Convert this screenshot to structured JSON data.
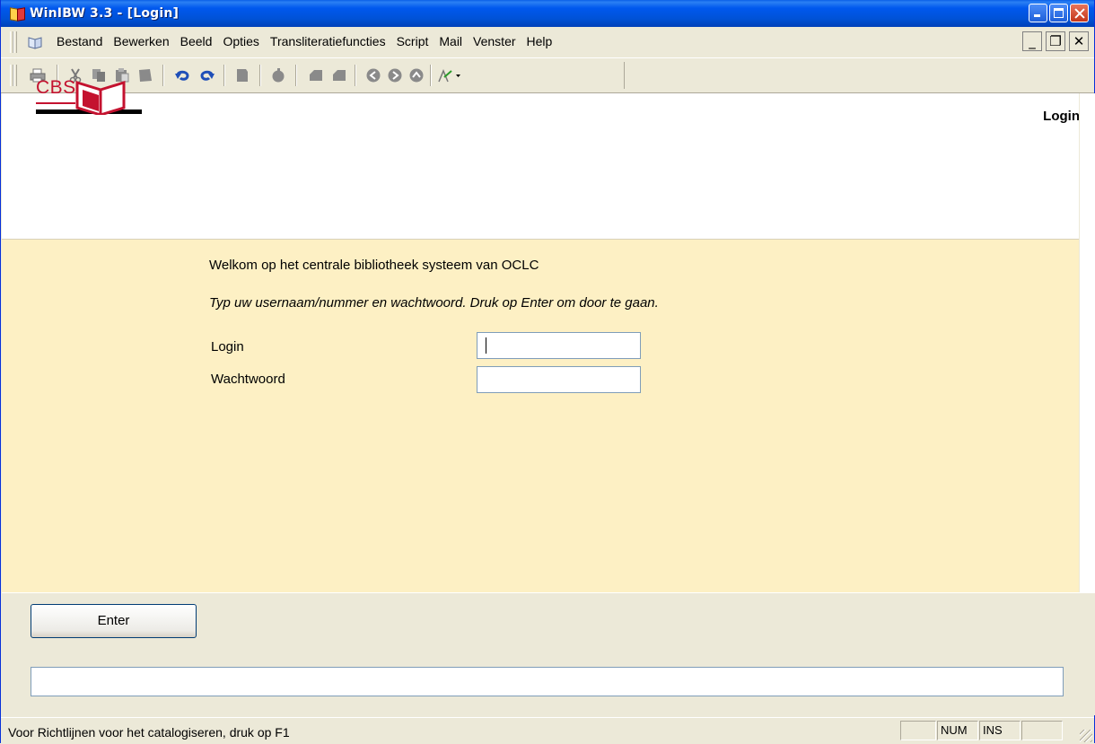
{
  "window": {
    "title": "WinIBW 3.3 - [Login]"
  },
  "menu": {
    "items": [
      "Bestand",
      "Bewerken",
      "Beeld",
      "Opties",
      "Transliteratiefuncties",
      "Script",
      "Mail",
      "Venster",
      "Help"
    ]
  },
  "toolbar": {
    "icons": [
      "print-icon",
      "cut-icon",
      "copy-icon",
      "paste-icon",
      "save-icon",
      "undo-icon",
      "redo-icon",
      "document-icon",
      "search-icon",
      "previous-page-icon",
      "next-page-icon",
      "back-icon",
      "forward-icon",
      "up-icon",
      "char-map-icon"
    ]
  },
  "header": {
    "logo_text": "CBS",
    "page_label": "Login"
  },
  "form": {
    "welcome": "Welkom op het centrale bibliotheek systeem van OCLC",
    "instruction": "Typ uw usernaam/nummer en wachtwoord. Druk op Enter om door te gaan.",
    "login_label": "Login",
    "login_value": "",
    "password_label": "Wachtwoord",
    "password_value": ""
  },
  "actions": {
    "enter_label": "Enter"
  },
  "command": {
    "value": ""
  },
  "status": {
    "text": "Voor Richtlijnen voor het catalogiseren, druk op F1",
    "num": "NUM",
    "ins": "INS"
  },
  "colors": {
    "brand_red": "#c4122f",
    "form_background": "#fdf0c4",
    "titlebar_blue": "#0058ee"
  }
}
